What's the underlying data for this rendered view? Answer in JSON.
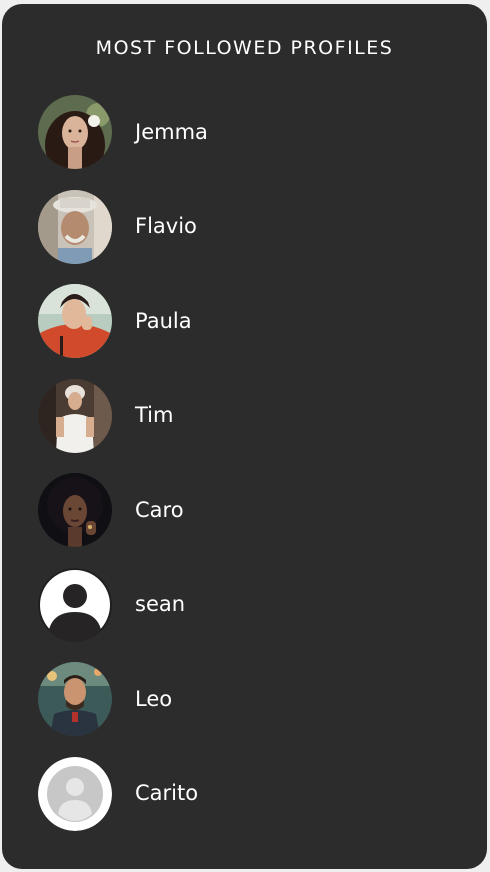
{
  "panel": {
    "title": "MOST FOLLOWED PROFILES"
  },
  "profiles": [
    {
      "name": "Jemma",
      "avatar": "photo"
    },
    {
      "name": "Flavio",
      "avatar": "photo"
    },
    {
      "name": "Paula",
      "avatar": "photo"
    },
    {
      "name": "Tim",
      "avatar": "photo"
    },
    {
      "name": "Caro",
      "avatar": "photo"
    },
    {
      "name": "sean",
      "avatar": "default-user-icon"
    },
    {
      "name": "Leo",
      "avatar": "photo"
    },
    {
      "name": "Carito",
      "avatar": "default-user-placeholder-icon"
    }
  ],
  "colors": {
    "panel_bg": "#2c2c2c",
    "text": "#ffffff",
    "page_bg": "#efefef"
  }
}
